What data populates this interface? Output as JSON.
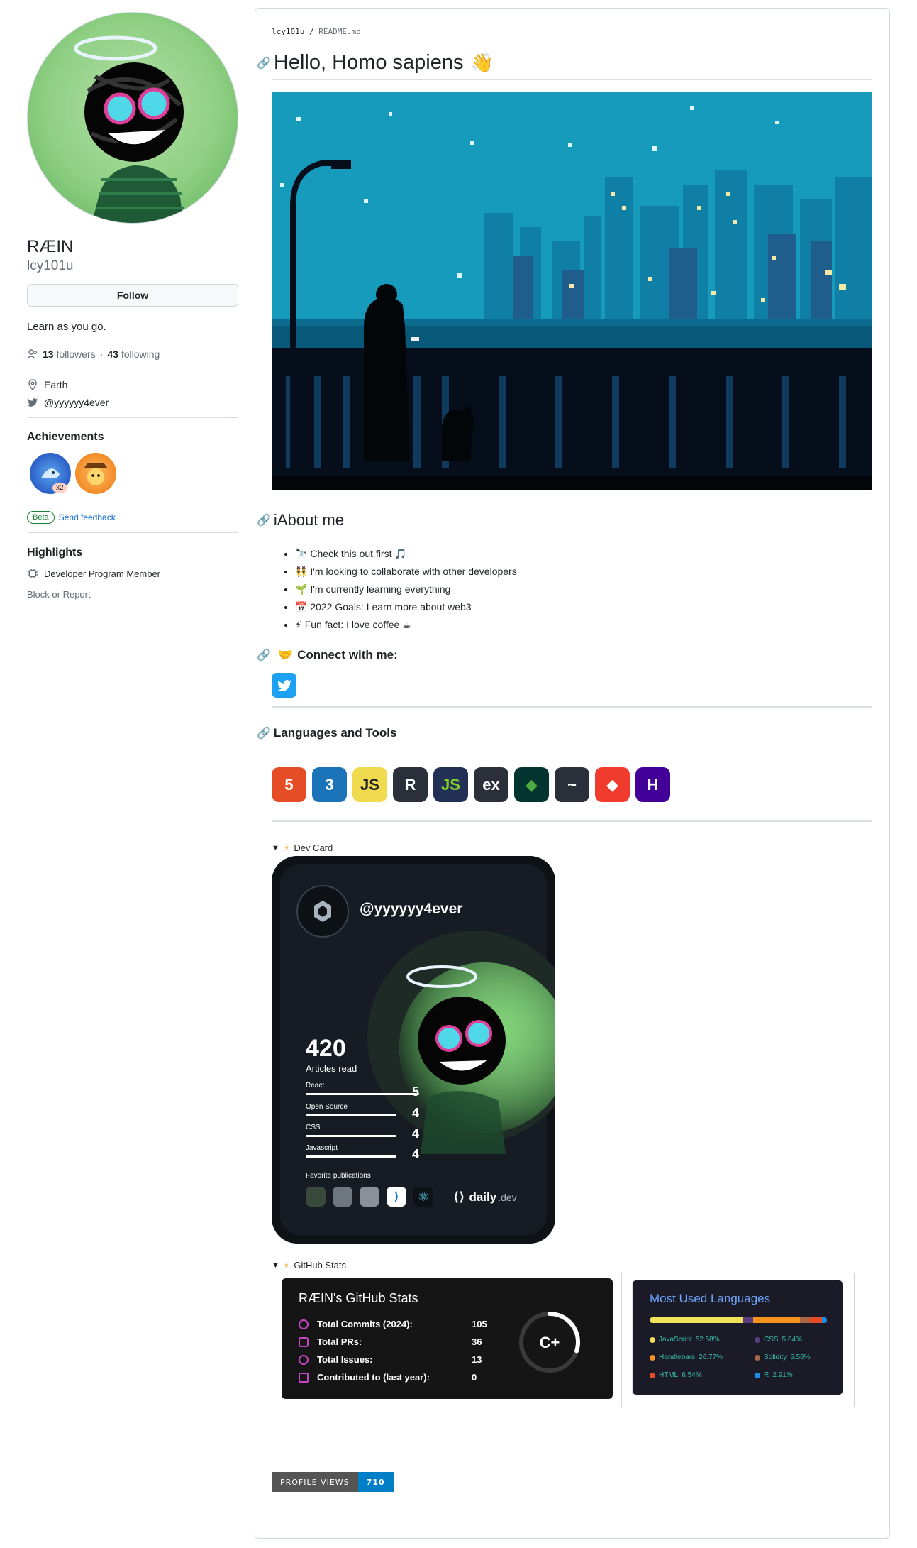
{
  "profile": {
    "name": "RÆIN",
    "login": "lcy101u",
    "follow_label": "Follow",
    "bio": "Learn as you go.",
    "followers_count": "13",
    "followers_label": "followers",
    "separator": "·",
    "following_count": "43",
    "following_label": "following",
    "location": "Earth",
    "twitter": "@yyyyyy4ever"
  },
  "achievements": {
    "title": "Achievements",
    "badge_multiplier": "x2",
    "beta_label": "Beta",
    "feedback_label": "Send feedback"
  },
  "highlights": {
    "title": "Highlights",
    "item": "Developer Program Member",
    "block_label": "Block or Report"
  },
  "readme": {
    "breadcrumb_user": "lcy101u",
    "breadcrumb_sep": "/",
    "breadcrumb_file": "README.md",
    "title": "Hello, Homo sapiens",
    "title_emoji": "👋",
    "about_title": "iAbout me",
    "about_items": [
      {
        "icon": "🔭",
        "text": "Check this out first",
        "tail": "🎵"
      },
      {
        "icon": "👯",
        "text": "I'm looking to collaborate with other developers",
        "tail": ""
      },
      {
        "icon": "🌱",
        "text": "I'm currently learning everything",
        "tail": ""
      },
      {
        "icon": "📅",
        "text": "2022 Goals: Learn more about web3",
        "tail": ""
      },
      {
        "icon": "⚡",
        "text": "Fun fact: I love coffee",
        "tail": "☕"
      }
    ],
    "connect_title": "Connect with me:",
    "connect_emoji": "🤝",
    "languages_title": "Languages and Tools",
    "tools": [
      {
        "label": "5",
        "color": "#e44d26",
        "icon": "html5-icon"
      },
      {
        "label": "3",
        "color": "#1b73ba",
        "icon": "css3-icon"
      },
      {
        "label": "JS",
        "color": "#f0db4f",
        "icon": "javascript-icon"
      },
      {
        "label": "R",
        "color": "#2a2f3a",
        "icon": "r-icon"
      },
      {
        "label": "JS",
        "color": "#233056",
        "icon": "nodejs-icon"
      },
      {
        "label": "ex",
        "color": "#2a2f3a",
        "icon": "express-icon"
      },
      {
        "label": "◆",
        "color": "#023430",
        "icon": "mongodb-icon"
      },
      {
        "label": "~",
        "color": "#2a2f3a",
        "icon": "mysql-icon"
      },
      {
        "label": "◆",
        "color": "#f03c2e",
        "icon": "git-icon"
      },
      {
        "label": "H",
        "color": "#430098",
        "icon": "heroku-icon"
      }
    ],
    "devcard_summary": "Dev Card",
    "summary_emoji": "⚡",
    "github_stats_summary": "GitHub Stats"
  },
  "devcard": {
    "handle": "@yyyyyy4ever",
    "articles_count": "420",
    "articles_label": "Articles read",
    "tags": [
      {
        "name": "React",
        "count": "5"
      },
      {
        "name": "Open Source",
        "count": "4"
      },
      {
        "name": "CSS",
        "count": "4"
      },
      {
        "name": "Javascript",
        "count": "4"
      }
    ],
    "favorites_label": "Favorite publications",
    "brand_main": "daily",
    "brand_suffix": ".dev"
  },
  "github_stats": {
    "title": "RÆIN's GitHub Stats",
    "rows": [
      {
        "label": "Total Commits (2024):",
        "value": "105"
      },
      {
        "label": "Total PRs:",
        "value": "36"
      },
      {
        "label": "Total Issues:",
        "value": "13"
      },
      {
        "label": "Contributed to (last year):",
        "value": "0"
      }
    ],
    "grade": "C+",
    "grade_progress": 0.3
  },
  "languages_card": {
    "title": "Most Used Languages",
    "langs": [
      {
        "name": "JavaScript",
        "percent": "52.58%",
        "value": 52.58,
        "color": "#f1e05a"
      },
      {
        "name": "CSS",
        "percent": "5.64%",
        "value": 5.64,
        "color": "#563d7c"
      },
      {
        "name": "Handlebars",
        "percent": "26.77%",
        "value": 26.77,
        "color": "#f7931e"
      },
      {
        "name": "Solidity",
        "percent": "5.56%",
        "value": 5.56,
        "color": "#aa6746"
      },
      {
        "name": "HTML",
        "percent": "6.54%",
        "value": 6.54,
        "color": "#e34c26"
      },
      {
        "name": "R",
        "percent": "2.91%",
        "value": 2.91,
        "color": "#198ce7"
      }
    ]
  },
  "profile_views": {
    "label": "PROFILE VIEWS",
    "count": "710"
  },
  "colors": {
    "link": "#0969da",
    "text": "#1f2328",
    "muted": "#656d76",
    "border": "#d0d7de",
    "night_sky": "#159bbf"
  }
}
